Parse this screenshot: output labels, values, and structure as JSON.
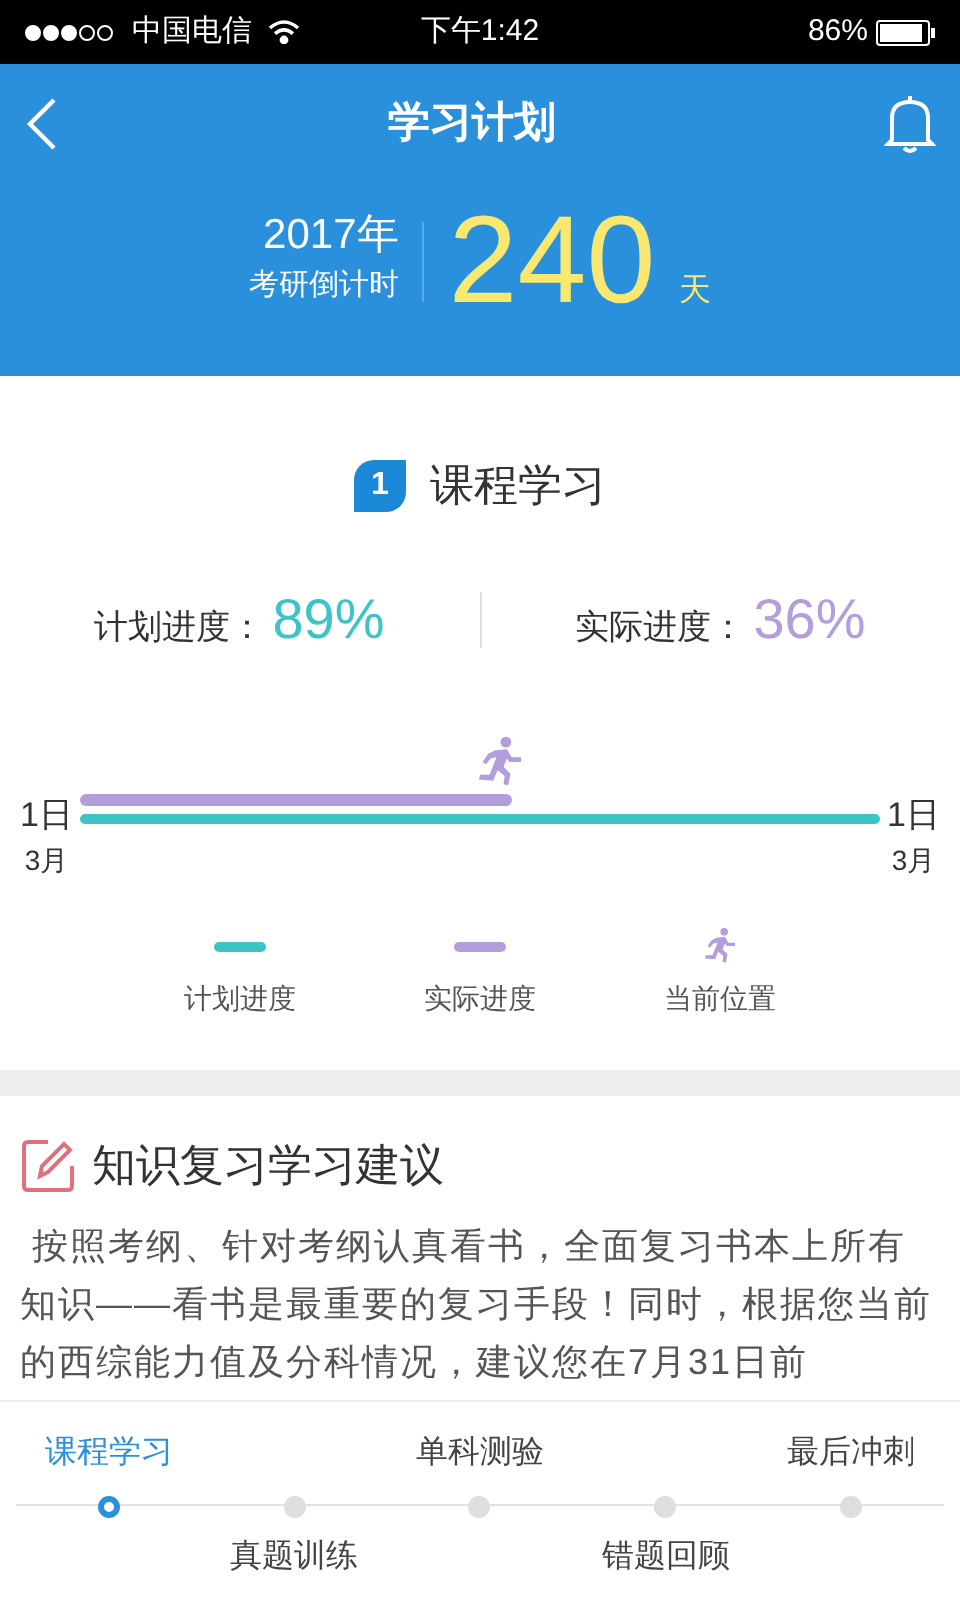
{
  "status_bar": {
    "carrier": "中国电信",
    "time": "下午1:42",
    "battery": "86%"
  },
  "header": {
    "title": "学习计划",
    "year": "2017年",
    "countdown_label": "考研倒计时",
    "days": "240",
    "days_unit": "天"
  },
  "course": {
    "badge": "1",
    "title": "课程学习",
    "plan_label": "计划进度：",
    "plan_value": "89%",
    "actual_label": "实际进度：",
    "actual_value": "36%",
    "timeline": {
      "start_day": "1日",
      "start_month": "3月",
      "end_day": "1日",
      "end_month": "3月",
      "actual_bar": {
        "level": 0.54
      }
    },
    "legend": [
      {
        "kind": "line",
        "label": "计划进度",
        "color": "#3cc4c6"
      },
      {
        "kind": "line",
        "label": "实际进度",
        "color": "#b39ddb"
      },
      {
        "kind": "runner",
        "label": "当前位置",
        "color": "#b39ddb"
      }
    ]
  },
  "advice": {
    "title": "知识复习学习建议",
    "text": " 按照考纲、针对考纲认真看书，全面复习书本上所有知识——看书是最重要的复习手段！同时，根据您当前的西综能力值及分科情况，建议您在7月31日前"
  },
  "steps": [
    {
      "label": "课程学习",
      "kind": "above",
      "selected": true
    },
    {
      "label": "真题训练",
      "kind": "below",
      "selected": false
    },
    {
      "label": "单科测验",
      "kind": "above",
      "selected": false
    },
    {
      "label": "错题回顾",
      "kind": "below",
      "selected": false
    },
    {
      "label": "最后冲刺",
      "kind": "above",
      "selected": false
    }
  ]
}
